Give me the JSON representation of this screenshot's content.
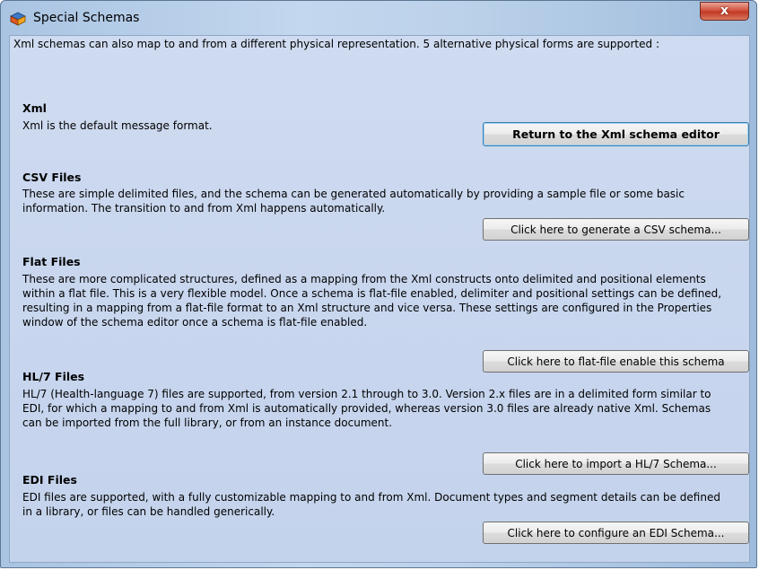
{
  "window": {
    "title": "Special Schemas",
    "close_glyph": "x",
    "icon": "app-cube-icon"
  },
  "intro": "Xml schemas can also map to and from a different physical representation.  5 alternative physical forms are supported :",
  "sections": {
    "xml": {
      "heading": "Xml",
      "description": "Xml is the default message format.",
      "button": "Return to the Xml schema editor"
    },
    "csv": {
      "heading": "CSV Files",
      "description": "These are simple delimited files, and the schema can be generated automatically by providing a sample file or some basic information.  The transition to and from Xml happens automatically.",
      "button": "Click here to generate a CSV schema..."
    },
    "flat": {
      "heading": "Flat Files",
      "description": "These are more complicated structures, defined as a mapping from the Xml constructs onto delimited and positional elements within a flat file.  This is a very flexible model.  Once a schema is flat-file enabled, delimiter and positional settings can be defined, resulting in a mapping from a flat-file format to an Xml structure and vice versa.  These settings are configured in the Properties window of the schema editor once a schema is flat-file enabled.",
      "button": "Click here to flat-file enable this schema"
    },
    "hl7": {
      "heading": "HL/7 Files",
      "description": "HL/7 (Health-language 7) files are supported, from version 2.1 through to 3.0.  Version 2.x files are in a delimited form similar to EDI, for which a mapping to and from Xml is automatically provided, whereas version 3.0 files are already native Xml. Schemas can be imported from the full library, or from an instance document.",
      "button": "Click here to import a HL/7 Schema..."
    },
    "edi": {
      "heading": "EDI Files",
      "description": "EDI files are supported, with a fully customizable mapping to and from Xml.  Document types and segment details can be defined in a library, or files can be handled generically.",
      "button": "Click here to configure an EDI Schema..."
    }
  }
}
